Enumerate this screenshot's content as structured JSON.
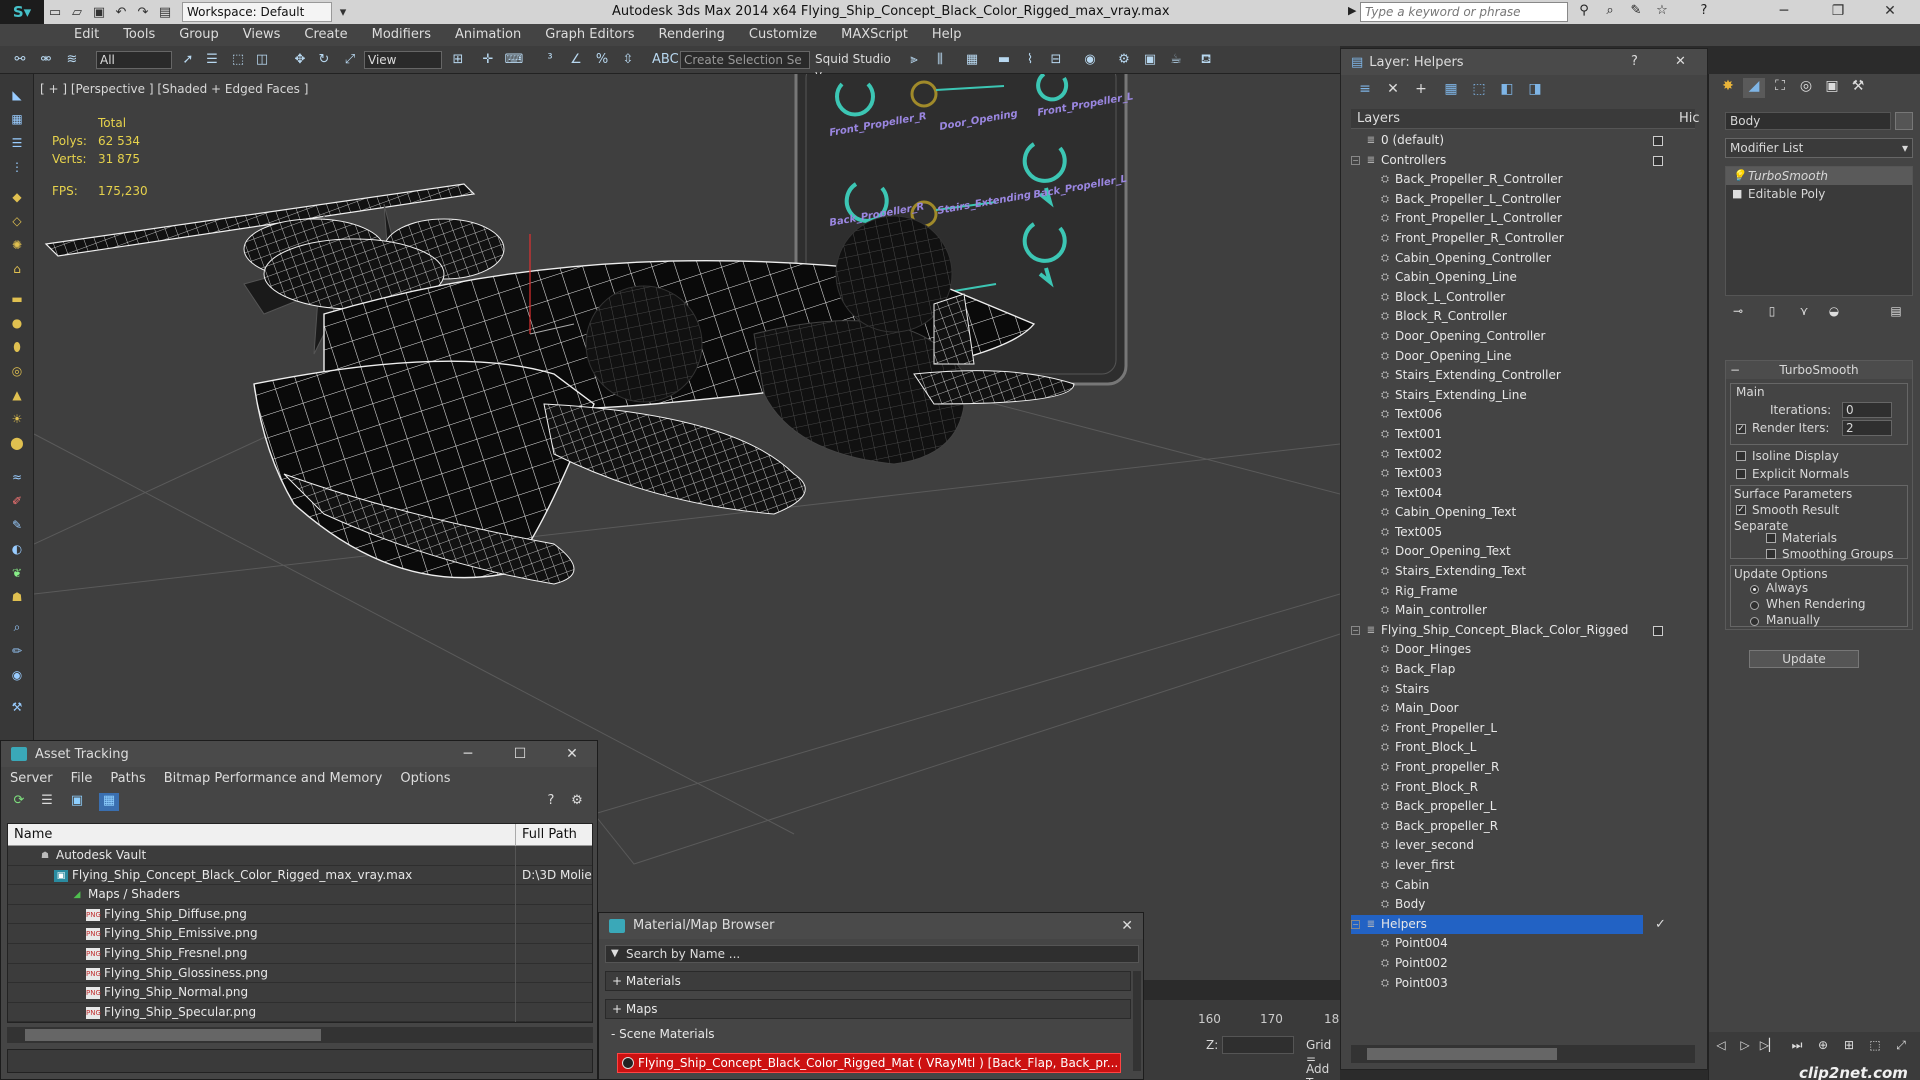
{
  "titlebar": {
    "workspace": "Workspace: Default",
    "title": "Autodesk 3ds Max  2014 x64     Flying_Ship_Concept_Black_Color_Rigged_max_vray.max",
    "search_placeholder": "Type a keyword or phrase"
  },
  "menu": [
    "Edit",
    "Tools",
    "Group",
    "Views",
    "Create",
    "Modifiers",
    "Animation",
    "Graph Editors",
    "Rendering",
    "Customize",
    "MAXScript",
    "Help"
  ],
  "toolbar": {
    "filter": "All",
    "ref_coord": "View",
    "selection_set": "Create Selection Se",
    "squid": "Squid Studio v"
  },
  "viewport": {
    "label": "[ + ] [Perspective ] [Shaded + Edged Faces ]",
    "total_label": "Total",
    "polys_label": "Polys:",
    "polys": "62 534",
    "verts_label": "Verts:",
    "verts": "31 875",
    "fps_label": "FPS:",
    "fps": "175,230",
    "rig_labels": [
      "Front_Propeller_R",
      "Door_Opening",
      "Front_Propeller_L",
      "Back_Propeller_R",
      "Stairs_Extending",
      "Back_Propeller_L"
    ]
  },
  "timeline": {
    "ticks": [
      "160",
      "170",
      "18"
    ]
  },
  "coordbar": {
    "z_label": "Z:",
    "grid_label": "Grid =",
    "addt_label": "Add T"
  },
  "layer_panel": {
    "title": "Layer: Helpers",
    "help": "?",
    "close": "✕",
    "col_layers": "Layers",
    "col_hide": "Hic",
    "rows": [
      {
        "text": "0 (default)",
        "level": 0,
        "type": "layer",
        "box": true
      },
      {
        "text": "Controllers",
        "level": 0,
        "type": "layer",
        "box": true,
        "expander": "−"
      },
      {
        "text": "Back_Propeller_R_Controller",
        "level": 1,
        "type": "obj"
      },
      {
        "text": "Back_Propeller_L_Controller",
        "level": 1,
        "type": "obj"
      },
      {
        "text": "Front_Propeller_L_Controller",
        "level": 1,
        "type": "obj"
      },
      {
        "text": "Front_Propeller_R_Controller",
        "level": 1,
        "type": "obj"
      },
      {
        "text": "Cabin_Opening_Controller",
        "level": 1,
        "type": "obj"
      },
      {
        "text": "Cabin_Opening_Line",
        "level": 1,
        "type": "obj"
      },
      {
        "text": "Block_L_Controller",
        "level": 1,
        "type": "obj"
      },
      {
        "text": "Block_R_Controller",
        "level": 1,
        "type": "obj"
      },
      {
        "text": "Door_Opening_Controller",
        "level": 1,
        "type": "obj"
      },
      {
        "text": "Door_Opening_Line",
        "level": 1,
        "type": "obj"
      },
      {
        "text": "Stairs_Extending_Controller",
        "level": 1,
        "type": "obj"
      },
      {
        "text": "Stairs_Extending_Line",
        "level": 1,
        "type": "obj"
      },
      {
        "text": "Text006",
        "level": 1,
        "type": "obj"
      },
      {
        "text": "Text001",
        "level": 1,
        "type": "obj"
      },
      {
        "text": "Text002",
        "level": 1,
        "type": "obj"
      },
      {
        "text": "Text003",
        "level": 1,
        "type": "obj"
      },
      {
        "text": "Text004",
        "level": 1,
        "type": "obj"
      },
      {
        "text": "Cabin_Opening_Text",
        "level": 1,
        "type": "obj"
      },
      {
        "text": "Text005",
        "level": 1,
        "type": "obj"
      },
      {
        "text": "Door_Opening_Text",
        "level": 1,
        "type": "obj"
      },
      {
        "text": "Stairs_Extending_Text",
        "level": 1,
        "type": "obj"
      },
      {
        "text": "Rig_Frame",
        "level": 1,
        "type": "obj"
      },
      {
        "text": "Main_controller",
        "level": 1,
        "type": "obj"
      },
      {
        "text": "Flying_Ship_Concept_Black_Color_Rigged",
        "level": 0,
        "type": "layer",
        "box": true,
        "expander": "−"
      },
      {
        "text": "Door_Hinges",
        "level": 1,
        "type": "obj"
      },
      {
        "text": "Back_Flap",
        "level": 1,
        "type": "obj"
      },
      {
        "text": "Stairs",
        "level": 1,
        "type": "obj"
      },
      {
        "text": "Main_Door",
        "level": 1,
        "type": "obj"
      },
      {
        "text": "Front_Propeller_L",
        "level": 1,
        "type": "obj"
      },
      {
        "text": "Front_Block_L",
        "level": 1,
        "type": "obj"
      },
      {
        "text": "Front_propeller_R",
        "level": 1,
        "type": "obj"
      },
      {
        "text": "Front_Block_R",
        "level": 1,
        "type": "obj"
      },
      {
        "text": "Back_propeller_L",
        "level": 1,
        "type": "obj"
      },
      {
        "text": "Back_propeller_R",
        "level": 1,
        "type": "obj"
      },
      {
        "text": "lever_second",
        "level": 1,
        "type": "obj"
      },
      {
        "text": "lever_first",
        "level": 1,
        "type": "obj"
      },
      {
        "text": "Cabin",
        "level": 1,
        "type": "obj"
      },
      {
        "text": "Body",
        "level": 1,
        "type": "obj"
      },
      {
        "text": "Helpers",
        "level": 0,
        "type": "layer",
        "selected": true,
        "check": "✓",
        "expander": "−"
      },
      {
        "text": "Point004",
        "level": 1,
        "type": "obj"
      },
      {
        "text": "Point002",
        "level": 1,
        "type": "obj"
      },
      {
        "text": "Point003",
        "level": 1,
        "type": "obj"
      }
    ]
  },
  "command_panel": {
    "object_name": "Body",
    "modifier_list": "Modifier List",
    "stack": [
      "TurboSmooth",
      "Editable Poly"
    ],
    "turbosmooth": {
      "title": "TurboSmooth",
      "main": "Main",
      "iterations_label": "Iterations:",
      "iterations": "0",
      "render_iters_label": "Render Iters:",
      "render_iters": "2",
      "isoline": "Isoline Display",
      "explicit": "Explicit Normals",
      "surface_params": "Surface Parameters",
      "smooth_result": "Smooth Result",
      "separate": "Separate",
      "materials": "Materials",
      "smoothing_groups": "Smoothing Groups",
      "update_options": "Update Options",
      "always": "Always",
      "when_rendering": "When Rendering",
      "manually": "Manually",
      "update": "Update"
    },
    "watermark": "clip2net.com"
  },
  "asset_tracking": {
    "title": "Asset Tracking",
    "menu": [
      "Server",
      "File",
      "Paths",
      "Bitmap Performance and Memory",
      "Options"
    ],
    "col_name": "Name",
    "col_path": "Full Path",
    "rows": [
      {
        "text": "Autodesk Vault",
        "indent": 1,
        "icon": "vault",
        "path": ""
      },
      {
        "text": "Flying_Ship_Concept_Black_Color_Rigged_max_vray.max",
        "indent": 2,
        "icon": "max",
        "path": "D:\\3D Molie"
      },
      {
        "text": "Maps / Shaders",
        "indent": 3,
        "icon": "maps",
        "path": ""
      },
      {
        "text": "Flying_Ship_Diffuse.png",
        "indent": 4,
        "icon": "png",
        "path": ""
      },
      {
        "text": "Flying_Ship_Emissive.png",
        "indent": 4,
        "icon": "png",
        "path": ""
      },
      {
        "text": "Flying_Ship_Fresnel.png",
        "indent": 4,
        "icon": "png",
        "path": ""
      },
      {
        "text": "Flying_Ship_Glossiness.png",
        "indent": 4,
        "icon": "png",
        "path": ""
      },
      {
        "text": "Flying_Ship_Normal.png",
        "indent": 4,
        "icon": "png",
        "path": ""
      },
      {
        "text": "Flying_Ship_Specular.png",
        "indent": 4,
        "icon": "png",
        "path": ""
      }
    ],
    "png_label": "PNG"
  },
  "material_browser": {
    "title": "Material/Map Browser",
    "search": "Search by Name ...",
    "cat_materials": "+ Materials",
    "cat_maps": "+ Maps",
    "cat_scene": "- Scene Materials",
    "scene_material": "Flying_Ship_Concept_Black_Color_Rigged_Mat ( VRayMtl ) [Back_Flap, Back_pr..."
  },
  "colors": {
    "accent_selection": "#2262c4",
    "stats_yellow": "#e6d24c",
    "material_red": "#cc1111",
    "rig_teal": "#3cc6b4"
  }
}
